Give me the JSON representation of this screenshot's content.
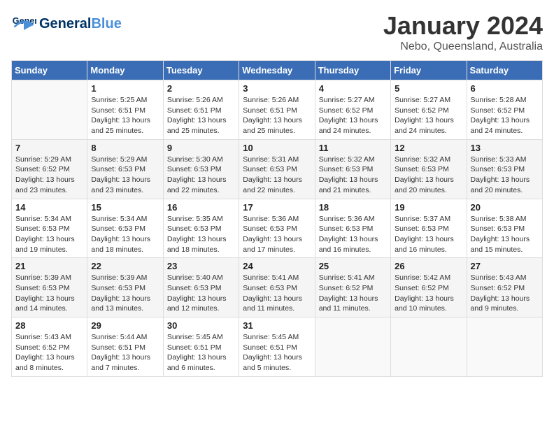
{
  "header": {
    "logo_general": "General",
    "logo_blue": "Blue",
    "title": "January 2024",
    "subtitle": "Nebo, Queensland, Australia"
  },
  "columns": [
    "Sunday",
    "Monday",
    "Tuesday",
    "Wednesday",
    "Thursday",
    "Friday",
    "Saturday"
  ],
  "weeks": [
    {
      "shade": "white",
      "days": [
        {
          "day": "",
          "info": ""
        },
        {
          "day": "1",
          "info": "Sunrise: 5:25 AM\nSunset: 6:51 PM\nDaylight: 13 hours\nand 25 minutes."
        },
        {
          "day": "2",
          "info": "Sunrise: 5:26 AM\nSunset: 6:51 PM\nDaylight: 13 hours\nand 25 minutes."
        },
        {
          "day": "3",
          "info": "Sunrise: 5:26 AM\nSunset: 6:51 PM\nDaylight: 13 hours\nand 25 minutes."
        },
        {
          "day": "4",
          "info": "Sunrise: 5:27 AM\nSunset: 6:52 PM\nDaylight: 13 hours\nand 24 minutes."
        },
        {
          "day": "5",
          "info": "Sunrise: 5:27 AM\nSunset: 6:52 PM\nDaylight: 13 hours\nand 24 minutes."
        },
        {
          "day": "6",
          "info": "Sunrise: 5:28 AM\nSunset: 6:52 PM\nDaylight: 13 hours\nand 24 minutes."
        }
      ]
    },
    {
      "shade": "shaded",
      "days": [
        {
          "day": "7",
          "info": "Sunrise: 5:29 AM\nSunset: 6:52 PM\nDaylight: 13 hours\nand 23 minutes."
        },
        {
          "day": "8",
          "info": "Sunrise: 5:29 AM\nSunset: 6:53 PM\nDaylight: 13 hours\nand 23 minutes."
        },
        {
          "day": "9",
          "info": "Sunrise: 5:30 AM\nSunset: 6:53 PM\nDaylight: 13 hours\nand 22 minutes."
        },
        {
          "day": "10",
          "info": "Sunrise: 5:31 AM\nSunset: 6:53 PM\nDaylight: 13 hours\nand 22 minutes."
        },
        {
          "day": "11",
          "info": "Sunrise: 5:32 AM\nSunset: 6:53 PM\nDaylight: 13 hours\nand 21 minutes."
        },
        {
          "day": "12",
          "info": "Sunrise: 5:32 AM\nSunset: 6:53 PM\nDaylight: 13 hours\nand 20 minutes."
        },
        {
          "day": "13",
          "info": "Sunrise: 5:33 AM\nSunset: 6:53 PM\nDaylight: 13 hours\nand 20 minutes."
        }
      ]
    },
    {
      "shade": "white",
      "days": [
        {
          "day": "14",
          "info": "Sunrise: 5:34 AM\nSunset: 6:53 PM\nDaylight: 13 hours\nand 19 minutes."
        },
        {
          "day": "15",
          "info": "Sunrise: 5:34 AM\nSunset: 6:53 PM\nDaylight: 13 hours\nand 18 minutes."
        },
        {
          "day": "16",
          "info": "Sunrise: 5:35 AM\nSunset: 6:53 PM\nDaylight: 13 hours\nand 18 minutes."
        },
        {
          "day": "17",
          "info": "Sunrise: 5:36 AM\nSunset: 6:53 PM\nDaylight: 13 hours\nand 17 minutes."
        },
        {
          "day": "18",
          "info": "Sunrise: 5:36 AM\nSunset: 6:53 PM\nDaylight: 13 hours\nand 16 minutes."
        },
        {
          "day": "19",
          "info": "Sunrise: 5:37 AM\nSunset: 6:53 PM\nDaylight: 13 hours\nand 16 minutes."
        },
        {
          "day": "20",
          "info": "Sunrise: 5:38 AM\nSunset: 6:53 PM\nDaylight: 13 hours\nand 15 minutes."
        }
      ]
    },
    {
      "shade": "shaded",
      "days": [
        {
          "day": "21",
          "info": "Sunrise: 5:39 AM\nSunset: 6:53 PM\nDaylight: 13 hours\nand 14 minutes."
        },
        {
          "day": "22",
          "info": "Sunrise: 5:39 AM\nSunset: 6:53 PM\nDaylight: 13 hours\nand 13 minutes."
        },
        {
          "day": "23",
          "info": "Sunrise: 5:40 AM\nSunset: 6:53 PM\nDaylight: 13 hours\nand 12 minutes."
        },
        {
          "day": "24",
          "info": "Sunrise: 5:41 AM\nSunset: 6:53 PM\nDaylight: 13 hours\nand 11 minutes."
        },
        {
          "day": "25",
          "info": "Sunrise: 5:41 AM\nSunset: 6:52 PM\nDaylight: 13 hours\nand 11 minutes."
        },
        {
          "day": "26",
          "info": "Sunrise: 5:42 AM\nSunset: 6:52 PM\nDaylight: 13 hours\nand 10 minutes."
        },
        {
          "day": "27",
          "info": "Sunrise: 5:43 AM\nSunset: 6:52 PM\nDaylight: 13 hours\nand 9 minutes."
        }
      ]
    },
    {
      "shade": "white",
      "days": [
        {
          "day": "28",
          "info": "Sunrise: 5:43 AM\nSunset: 6:52 PM\nDaylight: 13 hours\nand 8 minutes."
        },
        {
          "day": "29",
          "info": "Sunrise: 5:44 AM\nSunset: 6:51 PM\nDaylight: 13 hours\nand 7 minutes."
        },
        {
          "day": "30",
          "info": "Sunrise: 5:45 AM\nSunset: 6:51 PM\nDaylight: 13 hours\nand 6 minutes."
        },
        {
          "day": "31",
          "info": "Sunrise: 5:45 AM\nSunset: 6:51 PM\nDaylight: 13 hours\nand 5 minutes."
        },
        {
          "day": "",
          "info": ""
        },
        {
          "day": "",
          "info": ""
        },
        {
          "day": "",
          "info": ""
        }
      ]
    }
  ]
}
